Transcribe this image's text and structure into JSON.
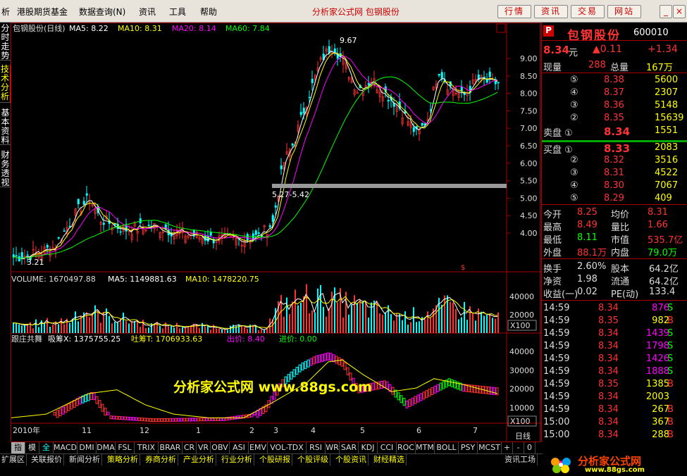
{
  "menubar": {
    "items": [
      "析",
      "港股期货基金",
      "数据查询(N)",
      "资讯",
      "工具",
      "帮助"
    ],
    "title": "分析家公式网 包钢股份",
    "buttons": [
      "行情",
      "资讯",
      "交易",
      "网站"
    ]
  },
  "side_tabs": [
    "分时走势",
    "技术分析",
    "基本资料",
    "财务透视"
  ],
  "price_panel": {
    "title": "包钢股份(日线)",
    "ma5": "MA5: 8.22",
    "ma10": "MA10: 8.31",
    "ma20": "MA20: 8.14",
    "ma60": "MA60: 7.84",
    "high_label": "9.67",
    "low_label": "3.21",
    "range_label": "5.27-5.42",
    "axis": [
      "9.00",
      "8.50",
      "8.00",
      "7.50",
      "7.00",
      "6.50",
      "6.00",
      "5.50",
      "5.00",
      "4.50",
      "4.00"
    ]
  },
  "volume_panel": {
    "volume": "VOLUME: 1670497.88",
    "ma5": "MA5: 1149881.63",
    "ma10": "MA10: 1478220.75",
    "axis": [
      "40000",
      "20000"
    ],
    "unit": "X100"
  },
  "indicator_panel": {
    "name": "跟庄共舞",
    "xi": "吸筹X: 1375755.25",
    "tu": "吐筹T: 1706933.63",
    "chu": "出价: 8.40",
    "jin": "进价: 0.00",
    "axis": [
      "40000",
      "30000",
      "20000",
      "10000"
    ],
    "unit": "X100",
    "watermark": "分析家公式网 www.88gs.com"
  },
  "date_axis": {
    "labels": [
      "2010年",
      "11",
      "12",
      "1",
      "2",
      "3",
      "4",
      "5",
      "6",
      "7"
    ],
    "period": "日线"
  },
  "quote": {
    "badge": "P",
    "name": "包钢股份",
    "code": "600010",
    "price": "8.34",
    "price_unit": "元",
    "change": "▲0.11",
    "change_pct": "+1.34",
    "xianliang_label": "现量",
    "xianliang": "288",
    "zongliang_label": "总量",
    "zongliang": "167万",
    "sell": [
      {
        "n": "⑤",
        "p": "8.38",
        "v": "5600"
      },
      {
        "n": "④",
        "p": "8.37",
        "v": "2307"
      },
      {
        "n": "③",
        "p": "8.36",
        "v": "5148"
      },
      {
        "n": "②",
        "p": "8.35",
        "v": "15639"
      },
      {
        "n": "卖盘 ①",
        "p": "8.34",
        "v": "1551"
      }
    ],
    "buy": [
      {
        "n": "买盘 ①",
        "p": "8.33",
        "v": "2083"
      },
      {
        "n": "②",
        "p": "8.32",
        "v": "3516"
      },
      {
        "n": "③",
        "p": "8.31",
        "v": "4522"
      },
      {
        "n": "④",
        "p": "8.30",
        "v": "7067"
      },
      {
        "n": "⑤",
        "p": "8.29",
        "v": "409"
      }
    ],
    "stats": [
      {
        "l1": "今开",
        "v1": "8.25",
        "l2": "均价",
        "v2": "8.31"
      },
      {
        "l1": "最高",
        "v1": "8.49",
        "l2": "量比",
        "v2": "1.66"
      },
      {
        "l1": "最低",
        "v1": "8.11",
        "l2": "市值",
        "v2": "535.7亿"
      },
      {
        "l1": "外盘",
        "v1": "88.1万",
        "l2": "内盘",
        "v2": "79.0万"
      }
    ],
    "stats2": [
      {
        "l1": "换手",
        "v1": "2.60%",
        "l2": "股本",
        "v2": "64.2亿"
      },
      {
        "l1": "净资",
        "v1": "1.98",
        "l2": "流通",
        "v2": "64.2亿"
      },
      {
        "l1": "收益(一)",
        "v1": "0.02",
        "l2": "PE(动)",
        "v2": "133.4"
      }
    ],
    "ticks": [
      {
        "t": "14:59",
        "p": "8.34",
        "v": "876",
        "s": "S"
      },
      {
        "t": "14:59",
        "p": "8.35",
        "v": "982",
        "s": "B"
      },
      {
        "t": "14:59",
        "p": "8.34",
        "v": "1439",
        "s": "S"
      },
      {
        "t": "14:59",
        "p": "8.34",
        "v": "1798",
        "s": "S"
      },
      {
        "t": "14:59",
        "p": "8.34",
        "v": "1426",
        "s": "S"
      },
      {
        "t": "14:59",
        "p": "8.34",
        "v": "1888",
        "s": "S"
      },
      {
        "t": "14:59",
        "p": "8.35",
        "v": "1385",
        "s": "B"
      },
      {
        "t": "14:59",
        "p": "8.34",
        "v": "2003",
        "s": ""
      },
      {
        "t": "14:59",
        "p": "8.34",
        "v": "267",
        "s": "B"
      },
      {
        "t": "15:00",
        "p": "8.34",
        "v": "367",
        "s": "B"
      },
      {
        "t": "15:00",
        "p": "8.34",
        "v": "288",
        "s": "B"
      }
    ]
  },
  "indicator_tabs": [
    "指标",
    "模板",
    "全部",
    "MACD",
    "DMI",
    "DMA",
    "FSL",
    "TRIX",
    "BRAR",
    "CR",
    "VR",
    "OBV",
    "ASI",
    "EMV",
    "VOL-TDX",
    "RSI",
    "WR",
    "SAR",
    "KDJ",
    "CCI",
    "ROC",
    "MTM",
    "BOLL",
    "PSY",
    "MCST",
    "+",
    "-",
    "0"
  ],
  "status_tabs": [
    "扩展区",
    "关联报价",
    "新闻分析",
    "策略分析",
    "券商分析",
    "产业分析",
    "行业分析",
    "个股研报",
    "个股评级",
    "个股资讯",
    "财经精选",
    "资讯工场"
  ],
  "logo": {
    "text": "分析家公式网",
    "url": "www.88gs.com"
  },
  "colors": {
    "up": "#ff3232",
    "down": "#00ffff",
    "ma5": "#ffffff",
    "ma10": "#ffff00",
    "ma20": "#ff00ff",
    "ma60": "#00ff00",
    "frame": "#aa0000"
  }
}
